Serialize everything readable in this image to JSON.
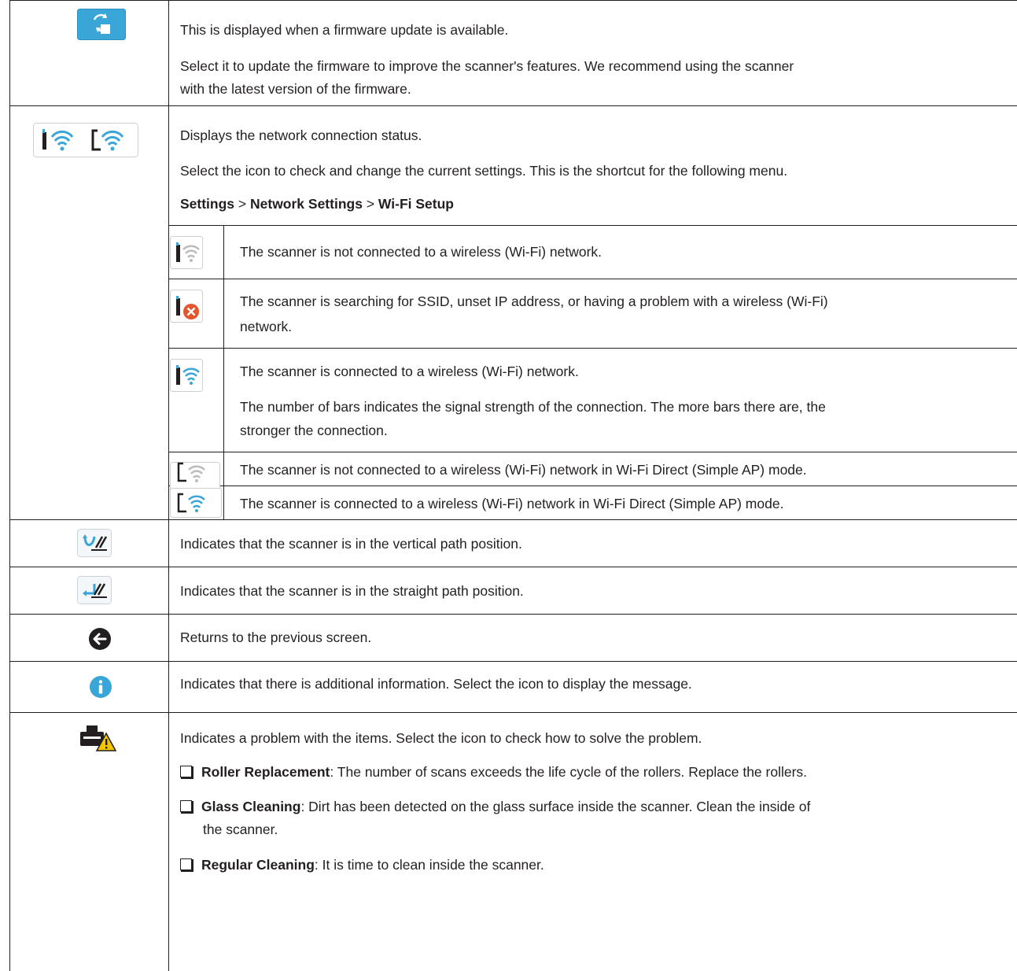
{
  "rows": {
    "firmware": {
      "line1": "This is displayed when a firmware update is available.",
      "line2": "Select it to update the firmware to improve the scanner's features. We recommend using the scanner",
      "line3": "with the latest version of the firmware."
    },
    "network": {
      "line1": "Displays the network connection status.",
      "line2": "Select the icon to check and change the current settings. This is the shortcut for the following menu.",
      "path_settings": "Settings",
      "path_sep1": " > ",
      "path_network": "Network Settings",
      "path_sep2": " > ",
      "path_wifi": "Wi-Fi Setup",
      "sub": [
        {
          "l1": "The scanner is not connected to a wireless (Wi-Fi) network.",
          "l2": ""
        },
        {
          "l1": "The scanner is searching for SSID, unset IP address, or having a problem with a wireless (Wi-Fi)",
          "l2": "network."
        },
        {
          "l1": "The scanner is connected to a wireless (Wi-Fi) network.",
          "l2": ""
        },
        {
          "l1": "The scanner is not connected to a wireless (Wi-Fi) network in Wi-Fi Direct (Simple AP) mode.",
          "l2": ""
        },
        {
          "l1": "The scanner is connected to a wireless (Wi-Fi) network in Wi-Fi Direct (Simple AP) mode.",
          "l2": ""
        }
      ],
      "bars_1": "The number of bars indicates the signal strength of the connection. The more bars there are, the",
      "bars_2": "stronger the connection."
    },
    "vertical": "Indicates that the scanner is in the vertical path position.",
    "straight": "Indicates that the scanner is in the straight path position.",
    "back": "Returns to the previous screen.",
    "info": "Indicates that there is additional information. Select the icon to display the message.",
    "problem": {
      "intro": "Indicates a problem with the items. Select the icon to check how to solve the problem.",
      "items": [
        {
          "name": "Roller Replacement",
          "desc": ": The number of scans exceeds the life cycle of the rollers. Replace the rollers.",
          "desc2": ""
        },
        {
          "name": "Glass Cleaning",
          "desc": ": Dirt has been detected on the glass surface inside the scanner. Clean the inside of",
          "desc2": "the scanner."
        },
        {
          "name": "Regular Cleaning",
          "desc": ": It is time to clean inside the scanner.",
          "desc2": ""
        }
      ]
    }
  },
  "icons": {
    "firmware": "firmware-update-icon",
    "network": "network-status-icon",
    "vertical": "vertical-path-icon",
    "straight": "straight-path-icon",
    "back": "back-arrow-icon",
    "info": "info-icon",
    "problem": "printer-warning-icon"
  },
  "colors": {
    "accent_blue": "#3aa6d8",
    "error_red": "#e4572e",
    "warning_yellow": "#f2c500",
    "dark": "#231f20"
  }
}
